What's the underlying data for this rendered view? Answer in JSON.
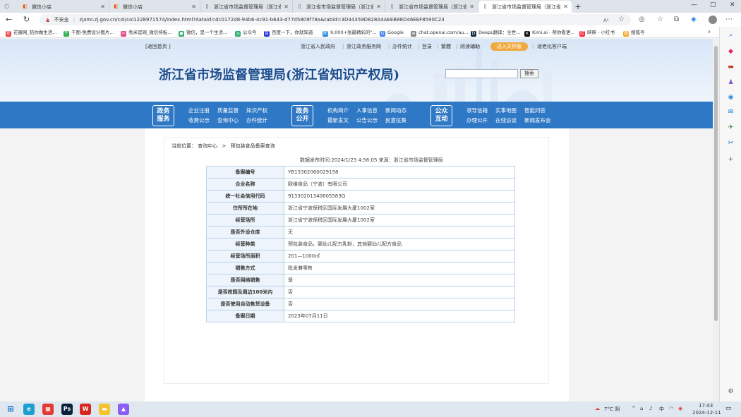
{
  "tabs": [
    {
      "title": "微信小店",
      "active": false
    },
    {
      "title": "微信小店",
      "active": false
    },
    {
      "title": "浙江省市场监督管理局（浙江省",
      "active": false
    },
    {
      "title": "浙江省市场监督管理局（浙江省",
      "active": false
    },
    {
      "title": "浙江省市场监督管理局（浙江省",
      "active": false
    },
    {
      "title": "浙江省市场监督管理局（浙江省",
      "active": true
    }
  ],
  "address": {
    "security_label": "不安全",
    "url": "zjamr.zj.gov.cn/col/col1228971574/index.html?dataid=dc0172d8-94b6-4c91-b643-d77d5809f78a&tabid=3D44359D828A4AEEB88D46EEF8590C23"
  },
  "bookmarks": [
    {
      "label": "花瓣网_陪你做生活...",
      "color": "#e8423f",
      "glyph": "花"
    },
    {
      "label": "千图-免费设计图片...",
      "color": "#2bb24c",
      "glyph": "千"
    },
    {
      "label": "秀米官网_微信排板...",
      "color": "#e44b8d",
      "glyph": "✂"
    },
    {
      "label": "微信，是一个生活...",
      "color": "#2aae67",
      "glyph": "●"
    },
    {
      "label": "公众号",
      "color": "#2aae67",
      "glyph": "◎"
    },
    {
      "label": "百度一下，你就知道",
      "color": "#2932e1",
      "glyph": "百"
    },
    {
      "label": "9,000+张最精彩的\"...",
      "color": "#1e88e5",
      "glyph": "图"
    },
    {
      "label": "Google",
      "color": "#4285f4",
      "glyph": "G"
    },
    {
      "label": "chat.openai.com/au...",
      "color": "#888888",
      "glyph": "⊕"
    },
    {
      "label": "DeepL翻译：全世...",
      "color": "#0f2b46",
      "glyph": "D"
    },
    {
      "label": "Kimi.ai - 帮你看更...",
      "color": "#111111",
      "glyph": "K"
    },
    {
      "label": "映映 - 小红书",
      "color": "#ff2442",
      "glyph": "红"
    },
    {
      "label": "搜狐号",
      "color": "#f5a623",
      "glyph": "搜"
    }
  ],
  "site": {
    "back_home": "[返回首页 ]",
    "top_links": [
      "浙江省人民政府",
      "浙江政务服务网",
      "办件统计",
      "登录",
      "繁體",
      "阅读辅助"
    ],
    "care_mode": "进入关怀版",
    "elder_mode": "适老化客户端",
    "title": "浙江省市场监督管理局(浙江省知识产权局)",
    "search_button": "搜索",
    "search_placeholder": ""
  },
  "nav": {
    "groups": [
      {
        "badge": [
          "政务",
          "服务"
        ],
        "links": [
          [
            "企业注册",
            "质量监督",
            "知识产权"
          ],
          [
            "收费公示",
            "查询中心",
            "办件统计"
          ]
        ]
      },
      {
        "badge": [
          "政务",
          "公开"
        ],
        "links": [
          [
            "机构简介",
            "人事信息",
            "新闻动态"
          ],
          [
            "最新发文",
            "公告公示",
            "民意征集"
          ]
        ]
      },
      {
        "badge": [
          "公众",
          "互动"
        ],
        "links": [
          [
            "领导信箱",
            "实事地图",
            "智能问答"
          ],
          [
            "办理公开",
            "在线访谈",
            "新闻发布会"
          ]
        ]
      }
    ]
  },
  "breadcrumb": {
    "prefix": "当前位置：",
    "items": [
      "查询中心",
      "预包装食品备案查询"
    ],
    "separator": ">"
  },
  "publish_info": "数据发布时间:2024/1/23 4:56:05 来源：浙江省市场监督管理局",
  "record": [
    {
      "key": "备案编号",
      "value": "YB13302060029158"
    },
    {
      "key": "企业名称",
      "value": "欧维食品（宁波）有限公司"
    },
    {
      "key": "统一社会信用代码",
      "value": "91330201340605583Q"
    },
    {
      "key": "住所所在地",
      "value": "浙江省宁波保税区国际发展大厦1002室"
    },
    {
      "key": "经营场所",
      "value": "浙江省宁波保税区国际发展大厦1002室"
    },
    {
      "key": "是否外设仓库",
      "value": "无"
    },
    {
      "key": "经营种类",
      "value": "预包装食品，婴幼儿配方乳粉，其他婴幼儿配方食品"
    },
    {
      "key": "经营场所面积",
      "value": "201—1000㎡"
    },
    {
      "key": "销售方式",
      "value": "批发兼零售"
    },
    {
      "key": "是否网络销售",
      "value": "是"
    },
    {
      "key": "是否校园及周边100米内",
      "value": "否"
    },
    {
      "key": "是否使用自动售货设备",
      "value": "否"
    },
    {
      "key": "备案日期",
      "value": "2023年07月11日"
    }
  ],
  "taskbar": {
    "weather": "7°C 阴",
    "time": "17:43",
    "date": "2024-12-11",
    "apps": [
      {
        "name": "windows-start-icon",
        "glyph": "⊞",
        "color": "#0067c0"
      },
      {
        "name": "edge-browser-icon",
        "glyph": "e",
        "color": "#1f9fd1"
      },
      {
        "name": "app-icon",
        "glyph": "▦",
        "color": "#e53935"
      },
      {
        "name": "photoshop-icon",
        "glyph": "Ps",
        "color": "#0a2239"
      },
      {
        "name": "wps-icon",
        "glyph": "W",
        "color": "#d7261f"
      },
      {
        "name": "file-explorer-icon",
        "glyph": "▬",
        "color": "#f4c430"
      },
      {
        "name": "app-icon",
        "glyph": "▲",
        "color": "#8b5cf6"
      }
    ]
  },
  "colors": {
    "nav_blue": "#2e78c5",
    "title_blue": "#1e4d8c",
    "care_orange": "#f0a940",
    "table_border": "#b9d1ea"
  }
}
